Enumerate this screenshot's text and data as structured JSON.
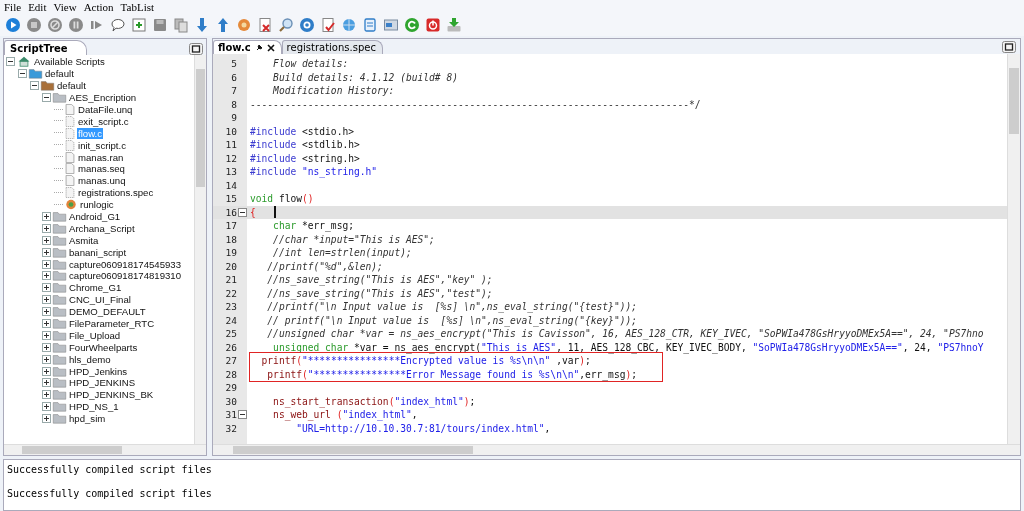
{
  "menu": [
    "File",
    "Edit",
    "View",
    "Action",
    "TabList"
  ],
  "tree_panel": {
    "tab": "ScriptTree",
    "items": [
      {
        "label": "Available Scripts",
        "kind": "home",
        "expanded": true,
        "selected": false,
        "children": [
          {
            "label": "default",
            "kind": "folder-blue",
            "expanded": true,
            "selected": false,
            "children": [
              {
                "label": "default",
                "kind": "folder-brown",
                "expanded": true,
                "selected": false,
                "children": [
                  {
                    "label": "AES_Encription",
                    "kind": "folder",
                    "expanded": true,
                    "selected": false,
                    "children": [
                      {
                        "label": "DataFile.unq",
                        "kind": "file",
                        "selected": false
                      },
                      {
                        "label": "exit_script.c",
                        "kind": "file-c",
                        "selected": false
                      },
                      {
                        "label": "flow.c",
                        "kind": "file-c",
                        "selected": true
                      },
                      {
                        "label": "init_script.c",
                        "kind": "file-c",
                        "selected": false
                      },
                      {
                        "label": "manas.ran",
                        "kind": "file",
                        "selected": false
                      },
                      {
                        "label": "manas.seq",
                        "kind": "file",
                        "selected": false
                      },
                      {
                        "label": "manas.unq",
                        "kind": "file",
                        "selected": false
                      },
                      {
                        "label": "registrations.spec",
                        "kind": "file-c",
                        "selected": false
                      },
                      {
                        "label": "runlogic",
                        "kind": "logic",
                        "selected": false
                      }
                    ]
                  },
                  {
                    "label": "Android_G1",
                    "kind": "folder",
                    "expanded": false,
                    "selected": false
                  },
                  {
                    "label": "Archana_Script",
                    "kind": "folder",
                    "expanded": false,
                    "selected": false
                  },
                  {
                    "label": "Asmita",
                    "kind": "folder",
                    "expanded": false,
                    "selected": false
                  },
                  {
                    "label": "banani_script",
                    "kind": "folder",
                    "expanded": false,
                    "selected": false
                  },
                  {
                    "label": "capture060918174545933",
                    "kind": "folder",
                    "expanded": false,
                    "selected": false
                  },
                  {
                    "label": "capture060918174819310",
                    "kind": "folder",
                    "expanded": false,
                    "selected": false
                  },
                  {
                    "label": "Chrome_G1",
                    "kind": "folder",
                    "expanded": false,
                    "selected": false
                  },
                  {
                    "label": "CNC_UI_Final",
                    "kind": "folder",
                    "expanded": false,
                    "selected": false
                  },
                  {
                    "label": "DEMO_DEFAULT",
                    "kind": "folder",
                    "expanded": false,
                    "selected": false
                  },
                  {
                    "label": "FileParameter_RTC",
                    "kind": "folder",
                    "expanded": false,
                    "selected": false
                  },
                  {
                    "label": "File_Upload",
                    "kind": "folder",
                    "expanded": false,
                    "selected": false
                  },
                  {
                    "label": "FourWheelparts",
                    "kind": "folder",
                    "expanded": false,
                    "selected": false
                  },
                  {
                    "label": "hls_demo",
                    "kind": "folder",
                    "expanded": false,
                    "selected": false
                  },
                  {
                    "label": "HPD_Jenkins",
                    "kind": "folder",
                    "expanded": false,
                    "selected": false
                  },
                  {
                    "label": "HPD_JENKINS",
                    "kind": "folder",
                    "expanded": false,
                    "selected": false
                  },
                  {
                    "label": "HPD_JENKINS_BK",
                    "kind": "folder",
                    "expanded": false,
                    "selected": false
                  },
                  {
                    "label": "HPD_NS_1",
                    "kind": "folder",
                    "expanded": false,
                    "selected": false
                  },
                  {
                    "label": "hpd_sim",
                    "kind": "folder",
                    "expanded": false,
                    "selected": false
                  }
                ]
              }
            ]
          }
        ]
      }
    ]
  },
  "editor": {
    "tabs": [
      {
        "label": "flow.c",
        "selected": true
      },
      {
        "label": "registrations.spec",
        "selected": false
      }
    ],
    "lines": [
      {
        "number": "5",
        "kind": "plain",
        "foldable": false,
        "segments": [
          {
            "kind": "comment",
            "text": "    Flow details:"
          }
        ]
      },
      {
        "number": "6",
        "kind": "plain",
        "foldable": false,
        "segments": [
          {
            "kind": "comment",
            "text": "    Build details: 4.1.12 (build# 8)"
          }
        ]
      },
      {
        "number": "7",
        "kind": "plain",
        "foldable": false,
        "segments": [
          {
            "kind": "comment",
            "text": "    Modification History:"
          }
        ]
      },
      {
        "number": "8",
        "kind": "plain",
        "foldable": false,
        "segments": [
          {
            "kind": "rule",
            "text": "----------------------------------------------------------------------------*/"
          }
        ]
      },
      {
        "number": "9",
        "kind": "plain",
        "foldable": false
      },
      {
        "number": "10",
        "kind": "plain",
        "foldable": false,
        "segments": [
          {
            "kind": "directive",
            "text": "#include"
          },
          {
            "kind": "plain",
            "text": " <stdio.h>"
          }
        ]
      },
      {
        "number": "11",
        "kind": "plain",
        "foldable": false,
        "segments": [
          {
            "kind": "directive",
            "text": "#include"
          },
          {
            "kind": "plain",
            "text": " <stdlib.h>"
          }
        ]
      },
      {
        "number": "12",
        "kind": "plain",
        "foldable": false,
        "segments": [
          {
            "kind": "directive",
            "text": "#include"
          },
          {
            "kind": "plain",
            "text": " <string.h>"
          }
        ]
      },
      {
        "number": "13",
        "kind": "plain",
        "foldable": false,
        "segments": [
          {
            "kind": "directive",
            "text": "#include"
          },
          {
            "kind": "string",
            "text": " \"ns_string.h\""
          }
        ]
      },
      {
        "number": "14",
        "kind": "plain",
        "foldable": false
      },
      {
        "number": "15",
        "kind": "plain",
        "foldable": false,
        "segments": [
          {
            "kind": "type",
            "text": "void"
          },
          {
            "kind": "plain",
            "text": " flow"
          },
          {
            "kind": "punct",
            "text": "()"
          }
        ]
      },
      {
        "number": "16",
        "kind": "current",
        "foldable": true,
        "segments": [
          {
            "kind": "punct",
            "text": "{"
          }
        ]
      },
      {
        "number": "17",
        "kind": "plain",
        "foldable": false,
        "segments": [
          {
            "kind": "type",
            "text": "    char"
          },
          {
            "kind": "plain",
            "text": " *err_msg;"
          }
        ]
      },
      {
        "number": "18",
        "kind": "plain",
        "foldable": false,
        "segments": [
          {
            "kind": "comment",
            "text": "    //char *input=\"This is AES\";"
          }
        ]
      },
      {
        "number": "19",
        "kind": "plain",
        "foldable": false,
        "segments": [
          {
            "kind": "comment",
            "text": "    //int len=strlen(input);"
          }
        ]
      },
      {
        "number": "20",
        "kind": "plain",
        "foldable": false,
        "segments": [
          {
            "kind": "comment",
            "text": "   //printf(\"%d\",&len);"
          }
        ]
      },
      {
        "number": "21",
        "kind": "plain",
        "foldable": false,
        "segments": [
          {
            "kind": "comment",
            "text": "   //ns_save_string(\"This is AES\",\"key\" );"
          }
        ]
      },
      {
        "number": "22",
        "kind": "plain",
        "foldable": false,
        "segments": [
          {
            "kind": "comment",
            "text": "   //ns_save_string(\"This is AES\",\"test\");"
          }
        ]
      },
      {
        "number": "23",
        "kind": "plain",
        "foldable": false,
        "segments": [
          {
            "kind": "comment",
            "text": "   //printf(\"\\n Input value is  [%s] \\n\",ns_eval_string(\"{test}\"));"
          }
        ]
      },
      {
        "number": "24",
        "kind": "plain",
        "foldable": false,
        "segments": [
          {
            "kind": "comment",
            "text": "   // printf(\"\\n Input value is  [%s] \\n\",ns_eval_string(\"{key}\"));"
          }
        ]
      },
      {
        "number": "25",
        "kind": "plain",
        "foldable": false,
        "segments": [
          {
            "kind": "comment",
            "text": "   //unsigned char *var = ns_aes_encrypt(\"This is Cavisson\", 16, AES_128_CTR, KEY_IVEC, \"SoPWIa478GsHryyoDMEx5A==\", 24, \"PS7hno"
          }
        ]
      },
      {
        "number": "26",
        "kind": "plain",
        "foldable": false,
        "segments": [
          {
            "kind": "type",
            "text": "    unsigned char"
          },
          {
            "kind": "plain",
            "text": " *var = ns_aes_encrypt("
          },
          {
            "kind": "string",
            "text": "\"This is AES\""
          },
          {
            "kind": "plain",
            "text": ", 11, AES_128_CBC, KEY_IVEC_BODY, "
          },
          {
            "kind": "string",
            "text": "\"SoPWIa478GsHryyoDMEx5A==\""
          },
          {
            "kind": "plain",
            "text": ", 24, "
          },
          {
            "kind": "string",
            "text": "\"PS7hnoY"
          }
        ]
      },
      {
        "number": "27",
        "kind": "boxed",
        "foldable": false,
        "segments": [
          {
            "kind": "func",
            "text": "  printf"
          },
          {
            "kind": "punct",
            "text": "("
          },
          {
            "kind": "string",
            "text": "\"****************Encrypted value is %s\\n\\n\""
          },
          {
            "kind": "plain",
            "text": " ,var"
          },
          {
            "kind": "punct",
            "text": ")"
          },
          {
            "kind": "plain",
            "text": ";"
          }
        ]
      },
      {
        "number": "28",
        "kind": "boxed",
        "foldable": false,
        "segments": [
          {
            "kind": "func",
            "text": "   printf"
          },
          {
            "kind": "punct",
            "text": "("
          },
          {
            "kind": "string",
            "text": "\"****************Error Message found is %s\\n\\n\""
          },
          {
            "kind": "plain",
            "text": ",err_msg"
          },
          {
            "kind": "punct",
            "text": ")"
          },
          {
            "kind": "plain",
            "text": ";"
          }
        ]
      },
      {
        "number": "29",
        "kind": "plain",
        "foldable": false
      },
      {
        "number": "30",
        "kind": "plain",
        "foldable": false,
        "segments": [
          {
            "kind": "func",
            "text": "    ns_start_transaction"
          },
          {
            "kind": "punct",
            "text": "("
          },
          {
            "kind": "string",
            "text": "\"index_html\""
          },
          {
            "kind": "punct",
            "text": ")"
          },
          {
            "kind": "plain",
            "text": ";"
          }
        ]
      },
      {
        "number": "31",
        "kind": "plain",
        "foldable": true,
        "segments": [
          {
            "kind": "func",
            "text": "    ns_web_url"
          },
          {
            "kind": "punct",
            "text": " ("
          },
          {
            "kind": "string",
            "text": "\"index_html\""
          },
          {
            "kind": "plain",
            "text": ","
          }
        ]
      },
      {
        "number": "32",
        "kind": "plain",
        "foldable": false,
        "segments": [
          {
            "kind": "string",
            "text": "        \"URL=http://10.10.30.7:81/tours/index.html\""
          },
          {
            "kind": "plain",
            "text": ","
          }
        ]
      }
    ]
  },
  "output": {
    "lines": [
      "Successfully compiled script files",
      "Successfully compiled script files"
    ]
  }
}
